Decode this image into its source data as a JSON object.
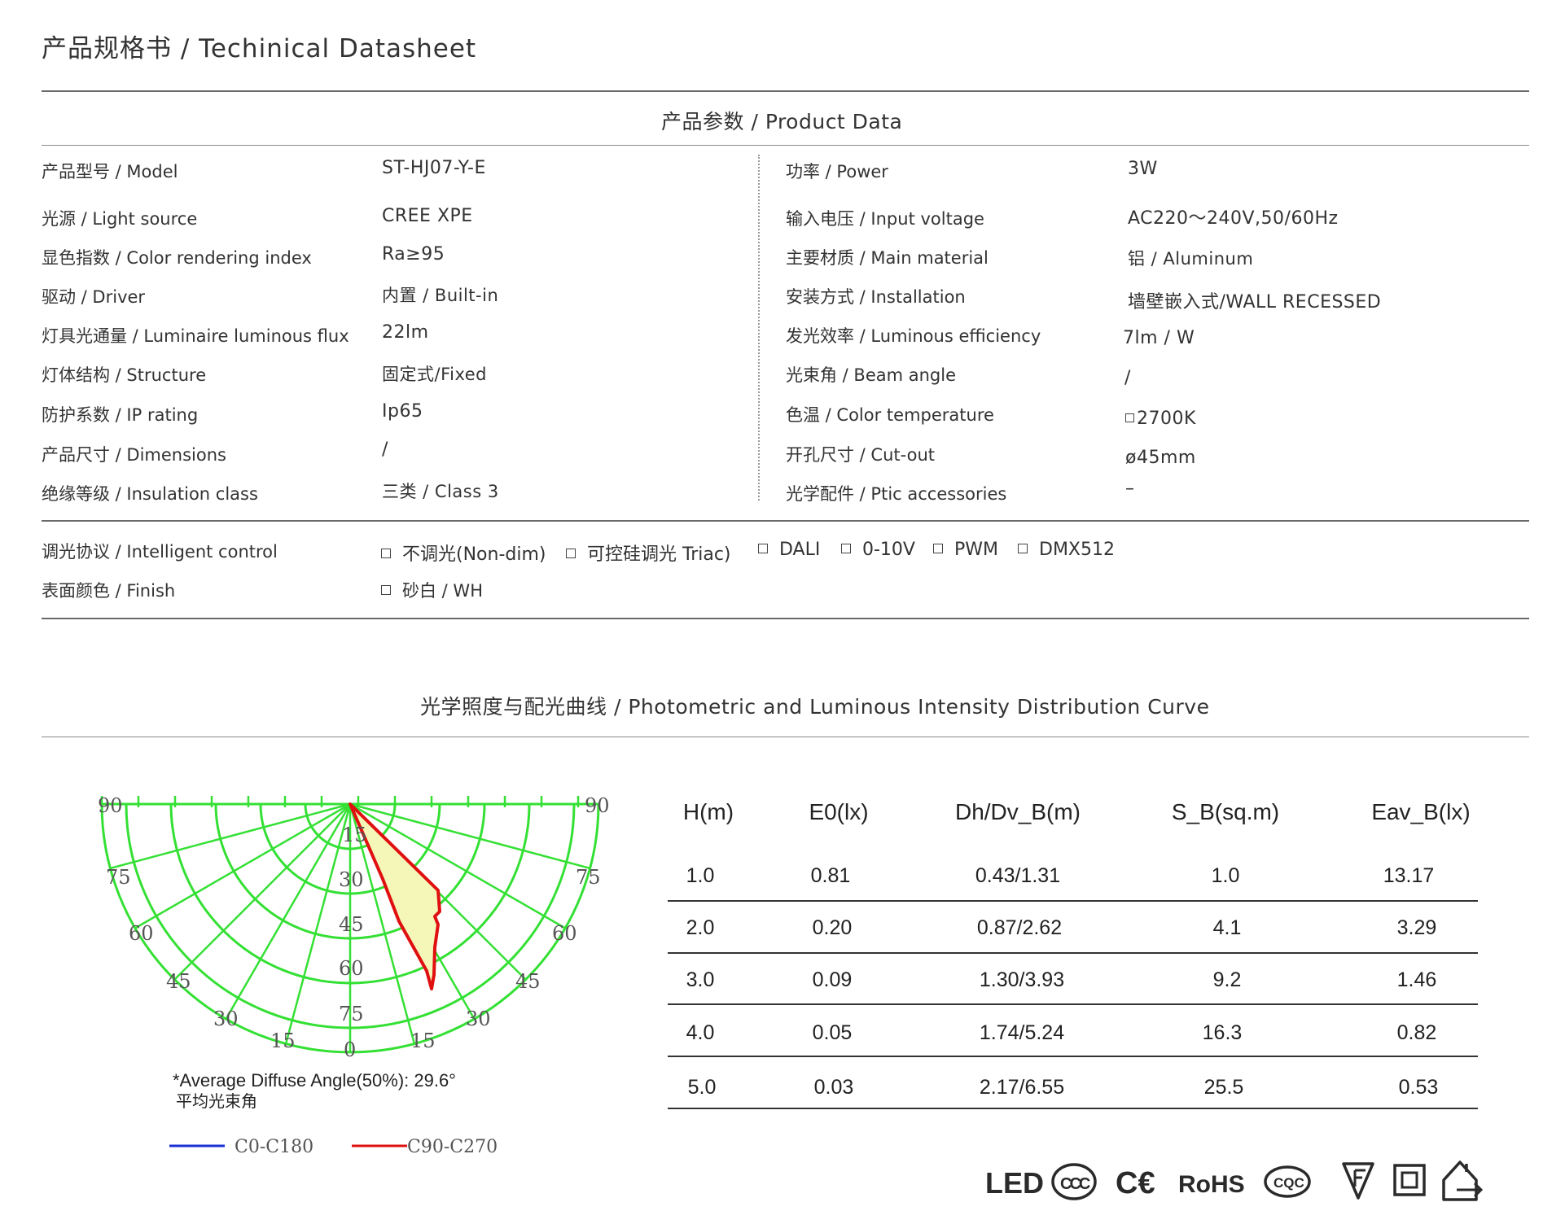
{
  "header": {
    "title": "产品规格书 / Techinical Datasheet"
  },
  "product_data": {
    "title": "产品参数 / Product Data",
    "left": [
      {
        "label": "产品型号 / Model",
        "value": "ST-HJ07-Y-E"
      },
      {
        "label": "光源 / Light source",
        "value": "CREE XPE"
      },
      {
        "label": "显色指数 / Color rendering index",
        "value": "Ra≥95"
      },
      {
        "label": "驱动 / Driver",
        "value": "内置 / Built-in"
      },
      {
        "label": "灯具光通量 / Luminaire luminous flux",
        "value": "22lm"
      },
      {
        "label": "灯体结构 / Structure",
        "value": "固定式/Fixed"
      },
      {
        "label": "防护系数  / IP  rating",
        "value": "Ip65"
      },
      {
        "label": "产品尺寸  / Dimensions",
        "value": "/"
      },
      {
        "label": "绝缘等级  / Insulation class",
        "value": "三类 / Class 3"
      }
    ],
    "right": [
      {
        "label": "功率 / Power",
        "value": "3W"
      },
      {
        "label": "输入电压 / Input voltage",
        "value": "AC220～240V,50/60Hz"
      },
      {
        "label": "主要材质 / Main material",
        "value": "铝 / Aluminum"
      },
      {
        "label": "安装方式 / Installation",
        "value": "墙壁嵌入式/WALL RECESSED"
      },
      {
        "label": "发光效率 / Luminous efficiency",
        "value": "7lm / W"
      },
      {
        "label": "光束角 / Beam angle",
        "value": "/"
      },
      {
        "label": "色温 / Color temperature",
        "value": "2700K"
      },
      {
        "label": "开孔尺寸 / Cut-out",
        "value": "ø45mm"
      },
      {
        "label": "光学配件 / Ptic accessories",
        "value": "–"
      }
    ],
    "control": {
      "label": "调光协议  / Intelligent control",
      "options": [
        "不调光(Non-dim)",
        "可控硅调光  Triac)",
        "DALI",
        "0-10V",
        "PWM",
        "DMX512"
      ]
    },
    "finish": {
      "label": "表面颜色  / Finish",
      "options": [
        "砂白 / WH"
      ]
    }
  },
  "photometric": {
    "title": "光学照度与配光曲线 / Photometric and Luminous Intensity Distribution Curve",
    "polar": {
      "left_angle_labels": [
        "90",
        "75",
        "60",
        "45",
        "30",
        "15"
      ],
      "right_angle_labels": [
        "90",
        "75",
        "60",
        "45",
        "30",
        "15"
      ],
      "bottom_label": "0",
      "radial_labels": [
        "15",
        "30",
        "45",
        "60",
        "75"
      ],
      "note": "*Average Diffuse Angle(50%): 29.6°",
      "note_cn": "平均光束角",
      "legend": [
        {
          "name": "C0-C180",
          "color": "#1a2fd6"
        },
        {
          "name": "C90-C270",
          "color": "#e01010"
        }
      ],
      "grid_color": "#34e034",
      "curve_fill": "#f4f7b8"
    },
    "table": {
      "headers": [
        "H(m)",
        "E0(lx)",
        "Dh/Dv_B(m)",
        "S_B(sq.m)",
        "Eav_B(lx)"
      ],
      "rows": [
        [
          "1.0",
          "0.81",
          "0.43/1.31",
          "1.0",
          "13.17"
        ],
        [
          "2.0",
          "0.20",
          "0.87/2.62",
          "4.1",
          "3.29"
        ],
        [
          "3.0",
          "0.09",
          "1.30/3.93",
          "9.2",
          "1.46"
        ],
        [
          "4.0",
          "0.05",
          "1.74/5.24",
          "16.3",
          "0.82"
        ],
        [
          "5.0",
          "0.03",
          "2.17/6.55",
          "25.5",
          "0.53"
        ]
      ]
    }
  },
  "certifications": {
    "led": "LED",
    "ccc": "CCC",
    "ce": "C€",
    "rohs": "RoHS",
    "cqc": "CQC",
    "icons": [
      "led-mark-icon",
      "ccc-mark-icon",
      "ce-mark-icon",
      "rohs-mark-icon",
      "cqc-mark-icon",
      "f-mark-icon",
      "class-ii-square-icon",
      "indoor-house-icon"
    ]
  }
}
